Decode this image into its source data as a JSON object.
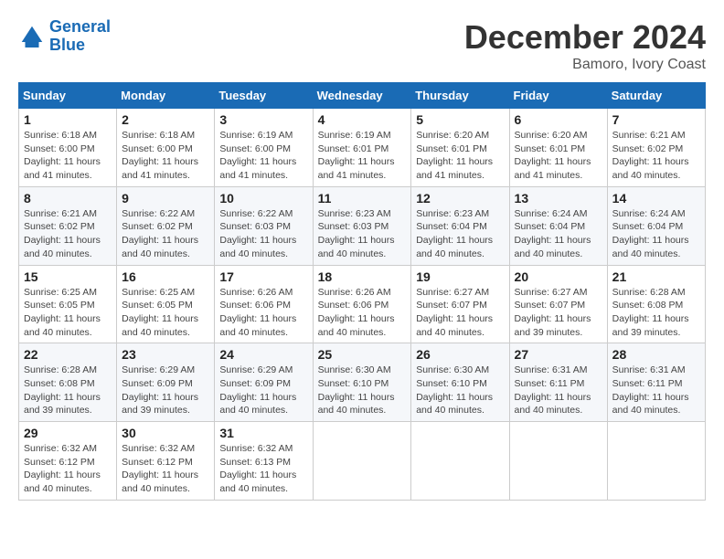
{
  "header": {
    "logo_line1": "General",
    "logo_line2": "Blue",
    "month_title": "December 2024",
    "location": "Bamoro, Ivory Coast"
  },
  "weekdays": [
    "Sunday",
    "Monday",
    "Tuesday",
    "Wednesday",
    "Thursday",
    "Friday",
    "Saturday"
  ],
  "weeks": [
    [
      {
        "day": "1",
        "info": "Sunrise: 6:18 AM\nSunset: 6:00 PM\nDaylight: 11 hours and 41 minutes."
      },
      {
        "day": "2",
        "info": "Sunrise: 6:18 AM\nSunset: 6:00 PM\nDaylight: 11 hours and 41 minutes."
      },
      {
        "day": "3",
        "info": "Sunrise: 6:19 AM\nSunset: 6:00 PM\nDaylight: 11 hours and 41 minutes."
      },
      {
        "day": "4",
        "info": "Sunrise: 6:19 AM\nSunset: 6:01 PM\nDaylight: 11 hours and 41 minutes."
      },
      {
        "day": "5",
        "info": "Sunrise: 6:20 AM\nSunset: 6:01 PM\nDaylight: 11 hours and 41 minutes."
      },
      {
        "day": "6",
        "info": "Sunrise: 6:20 AM\nSunset: 6:01 PM\nDaylight: 11 hours and 41 minutes."
      },
      {
        "day": "7",
        "info": "Sunrise: 6:21 AM\nSunset: 6:02 PM\nDaylight: 11 hours and 40 minutes."
      }
    ],
    [
      {
        "day": "8",
        "info": "Sunrise: 6:21 AM\nSunset: 6:02 PM\nDaylight: 11 hours and 40 minutes."
      },
      {
        "day": "9",
        "info": "Sunrise: 6:22 AM\nSunset: 6:02 PM\nDaylight: 11 hours and 40 minutes."
      },
      {
        "day": "10",
        "info": "Sunrise: 6:22 AM\nSunset: 6:03 PM\nDaylight: 11 hours and 40 minutes."
      },
      {
        "day": "11",
        "info": "Sunrise: 6:23 AM\nSunset: 6:03 PM\nDaylight: 11 hours and 40 minutes."
      },
      {
        "day": "12",
        "info": "Sunrise: 6:23 AM\nSunset: 6:04 PM\nDaylight: 11 hours and 40 minutes."
      },
      {
        "day": "13",
        "info": "Sunrise: 6:24 AM\nSunset: 6:04 PM\nDaylight: 11 hours and 40 minutes."
      },
      {
        "day": "14",
        "info": "Sunrise: 6:24 AM\nSunset: 6:04 PM\nDaylight: 11 hours and 40 minutes."
      }
    ],
    [
      {
        "day": "15",
        "info": "Sunrise: 6:25 AM\nSunset: 6:05 PM\nDaylight: 11 hours and 40 minutes."
      },
      {
        "day": "16",
        "info": "Sunrise: 6:25 AM\nSunset: 6:05 PM\nDaylight: 11 hours and 40 minutes."
      },
      {
        "day": "17",
        "info": "Sunrise: 6:26 AM\nSunset: 6:06 PM\nDaylight: 11 hours and 40 minutes."
      },
      {
        "day": "18",
        "info": "Sunrise: 6:26 AM\nSunset: 6:06 PM\nDaylight: 11 hours and 40 minutes."
      },
      {
        "day": "19",
        "info": "Sunrise: 6:27 AM\nSunset: 6:07 PM\nDaylight: 11 hours and 40 minutes."
      },
      {
        "day": "20",
        "info": "Sunrise: 6:27 AM\nSunset: 6:07 PM\nDaylight: 11 hours and 39 minutes."
      },
      {
        "day": "21",
        "info": "Sunrise: 6:28 AM\nSunset: 6:08 PM\nDaylight: 11 hours and 39 minutes."
      }
    ],
    [
      {
        "day": "22",
        "info": "Sunrise: 6:28 AM\nSunset: 6:08 PM\nDaylight: 11 hours and 39 minutes."
      },
      {
        "day": "23",
        "info": "Sunrise: 6:29 AM\nSunset: 6:09 PM\nDaylight: 11 hours and 39 minutes."
      },
      {
        "day": "24",
        "info": "Sunrise: 6:29 AM\nSunset: 6:09 PM\nDaylight: 11 hours and 40 minutes."
      },
      {
        "day": "25",
        "info": "Sunrise: 6:30 AM\nSunset: 6:10 PM\nDaylight: 11 hours and 40 minutes."
      },
      {
        "day": "26",
        "info": "Sunrise: 6:30 AM\nSunset: 6:10 PM\nDaylight: 11 hours and 40 minutes."
      },
      {
        "day": "27",
        "info": "Sunrise: 6:31 AM\nSunset: 6:11 PM\nDaylight: 11 hours and 40 minutes."
      },
      {
        "day": "28",
        "info": "Sunrise: 6:31 AM\nSunset: 6:11 PM\nDaylight: 11 hours and 40 minutes."
      }
    ],
    [
      {
        "day": "29",
        "info": "Sunrise: 6:32 AM\nSunset: 6:12 PM\nDaylight: 11 hours and 40 minutes."
      },
      {
        "day": "30",
        "info": "Sunrise: 6:32 AM\nSunset: 6:12 PM\nDaylight: 11 hours and 40 minutes."
      },
      {
        "day": "31",
        "info": "Sunrise: 6:32 AM\nSunset: 6:13 PM\nDaylight: 11 hours and 40 minutes."
      },
      null,
      null,
      null,
      null
    ]
  ]
}
